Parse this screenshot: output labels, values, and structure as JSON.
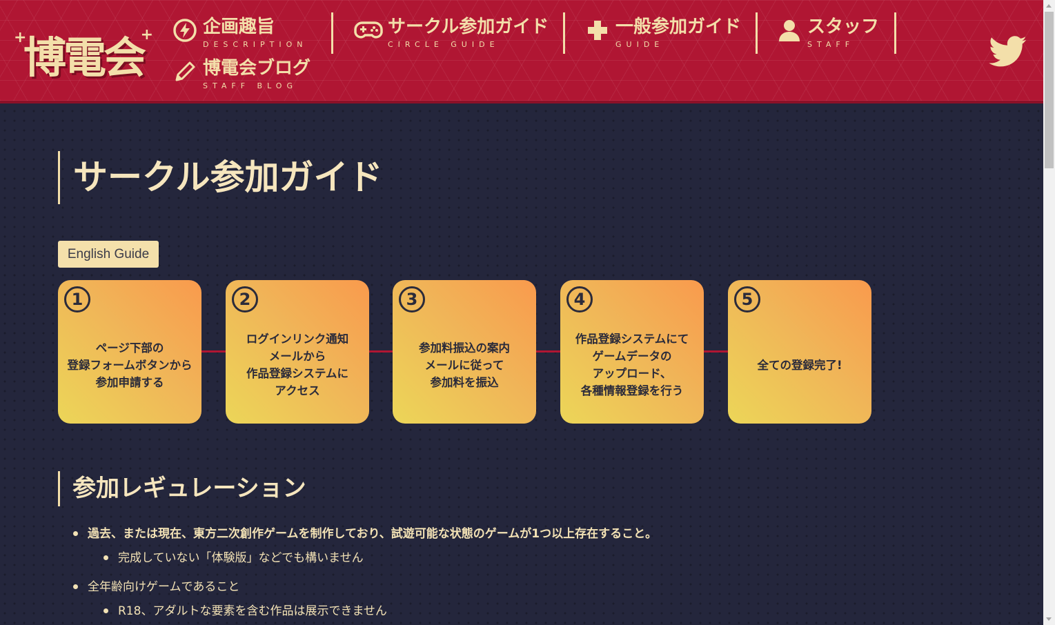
{
  "header": {
    "logo_text": "博電会",
    "nav": [
      {
        "jp": "企画趣旨",
        "en": "DESCRIPTION",
        "icon": "lightning-circle-icon"
      },
      {
        "jp": "サークル参加ガイド",
        "en": "CIRCLE GUIDE",
        "icon": "gamepad-icon"
      },
      {
        "jp": "一般参加ガイド",
        "en": "GUIDE",
        "icon": "plus-icon"
      },
      {
        "jp": "スタッフ",
        "en": "STAFF",
        "icon": "user-icon"
      },
      {
        "jp": "博電会ブログ",
        "en": "STAFF BLOG",
        "icon": "pencil-icon"
      }
    ],
    "social_icon": "twitter-icon"
  },
  "main": {
    "title": "サークル参加ガイド",
    "english_button": "English Guide",
    "steps": [
      {
        "num": "1",
        "text": "ページ下部の\n登録フォームボタンから\n参加申請する"
      },
      {
        "num": "2",
        "text": "ログインリンク通知\nメールから\n作品登録システムに\nアクセス"
      },
      {
        "num": "3",
        "text": "参加料振込の案内\nメールに従って\n参加料を振込"
      },
      {
        "num": "4",
        "text": "作品登録システムにて\nゲームデータの\nアップロード、\n各種情報登録を行う"
      },
      {
        "num": "5",
        "text": "全ての登録完了!"
      }
    ],
    "regulation_title": "参加レギュレーション",
    "regulations": [
      {
        "text": "過去、または現在、東方二次創作ゲームを制作しており、試遊可能な状態のゲームが1つ以上存在すること。",
        "sub": "完成していない「体験版」などでも構いません"
      },
      {
        "text": "全年齢向けゲームであること",
        "sub": "R18、アダルトな要素を含む作品は展示できません"
      }
    ]
  },
  "colors": {
    "header_bg": "#b01633",
    "page_bg": "#24263c",
    "accent_text": "#f3dfaa",
    "step_gradient_start": "#ecd658",
    "step_gradient_end": "#f99a4d"
  }
}
